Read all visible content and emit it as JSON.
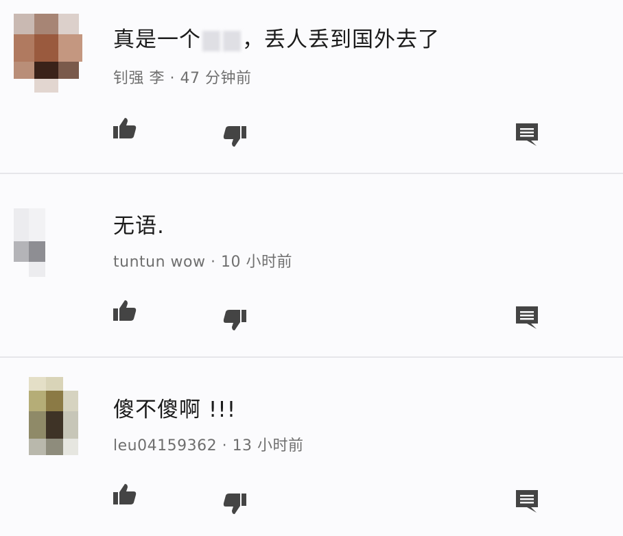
{
  "comments": [
    {
      "text_before": "真是一个",
      "text_after": "，丢人丢到国外去了",
      "author": "钊强 李",
      "time": "47 分钟前"
    },
    {
      "text": "无语.",
      "author": "tuntun wow",
      "time": "10 小时前"
    },
    {
      "text": "傻不傻啊 !!!",
      "author": "leu04159362",
      "time": "13 小时前"
    }
  ],
  "meta_separator": " · ",
  "icons": {
    "like": "thumbs-up-icon",
    "dislike": "thumbs-down-icon",
    "reply": "comment-reply-icon"
  },
  "colors": {
    "background": "#fbfbfd",
    "text": "#1b1b1b",
    "meta": "#6f6f6f",
    "icon": "#444444",
    "divider": "#e6e6ea"
  }
}
